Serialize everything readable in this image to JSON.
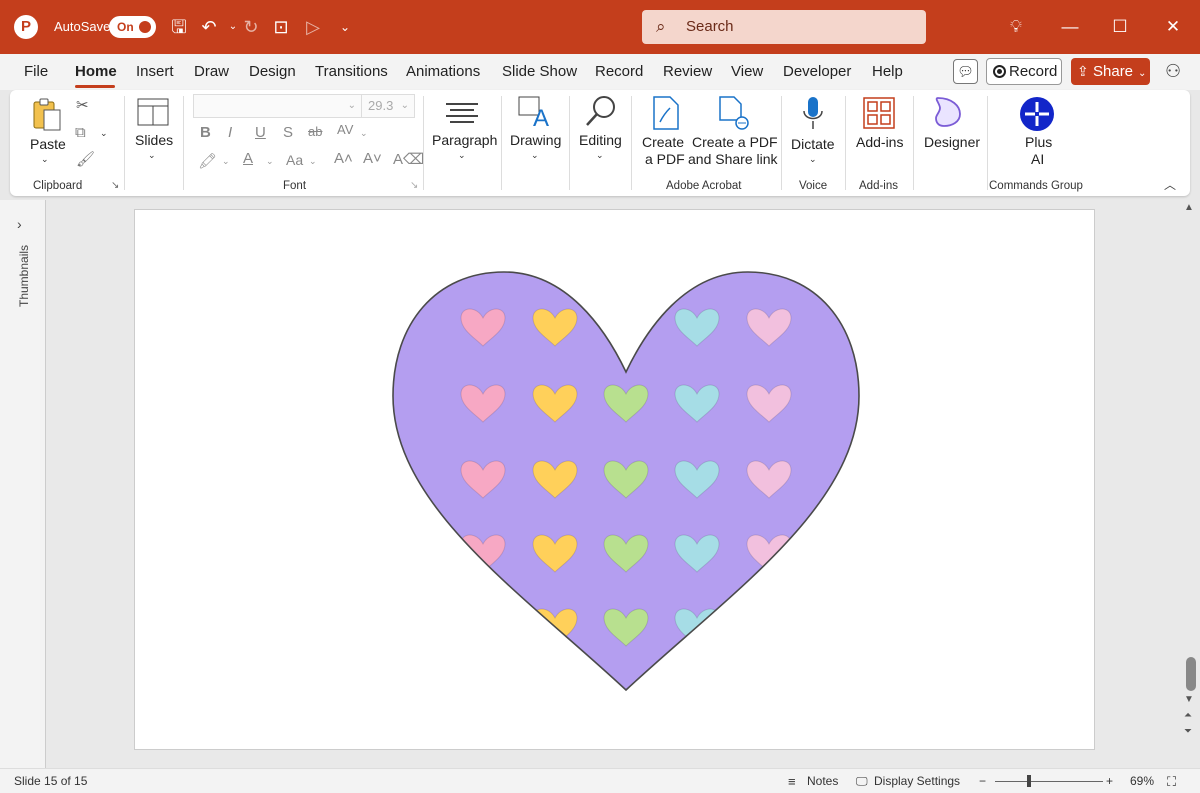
{
  "titlebar": {
    "autosave_label": "AutoSave",
    "autosave_state": "On",
    "search_placeholder": "Search",
    "accent_color": "#c43e1c"
  },
  "menu": {
    "tabs": [
      "File",
      "Home",
      "Insert",
      "Draw",
      "Design",
      "Transitions",
      "Animations",
      "Slide Show",
      "Record",
      "Review",
      "View",
      "Developer",
      "Help"
    ],
    "active_tab": "Home",
    "record_label": "Record",
    "share_label": "Share"
  },
  "ribbon": {
    "clipboard": {
      "paste": "Paste",
      "group": "Clipboard"
    },
    "slides": {
      "label": "Slides"
    },
    "font": {
      "size": "29.3",
      "group": "Font"
    },
    "paragraph": {
      "label": "Paragraph"
    },
    "drawing": {
      "label": "Drawing"
    },
    "editing": {
      "label": "Editing"
    },
    "acrobat": {
      "create_pdf_1": "Create",
      "create_pdf_2": "a PDF",
      "share_pdf_1": "Create a PDF",
      "share_pdf_2": "and Share link",
      "group": "Adobe Acrobat"
    },
    "voice": {
      "dictate": "Dictate",
      "group": "Voice"
    },
    "addins": {
      "label": "Add-ins",
      "group": "Add-ins"
    },
    "designer": {
      "label": "Designer"
    },
    "plusai": {
      "label_1": "Plus",
      "label_2": "AI",
      "group": "Commands Group"
    }
  },
  "panes": {
    "thumbnails_label": "Thumbnails"
  },
  "statusbar": {
    "slide_info": "Slide 15 of 15",
    "notes": "Notes",
    "display_settings": "Display Settings",
    "zoom_minus": "−",
    "zoom_plus": "+",
    "zoom_level": "69%"
  },
  "slide": {
    "heart_fill": "#b49ef0",
    "candy_colors": [
      "#f7a8c4",
      "#ffd05a",
      "#b8e08f",
      "#a6dde6",
      "#f2c0de"
    ]
  }
}
